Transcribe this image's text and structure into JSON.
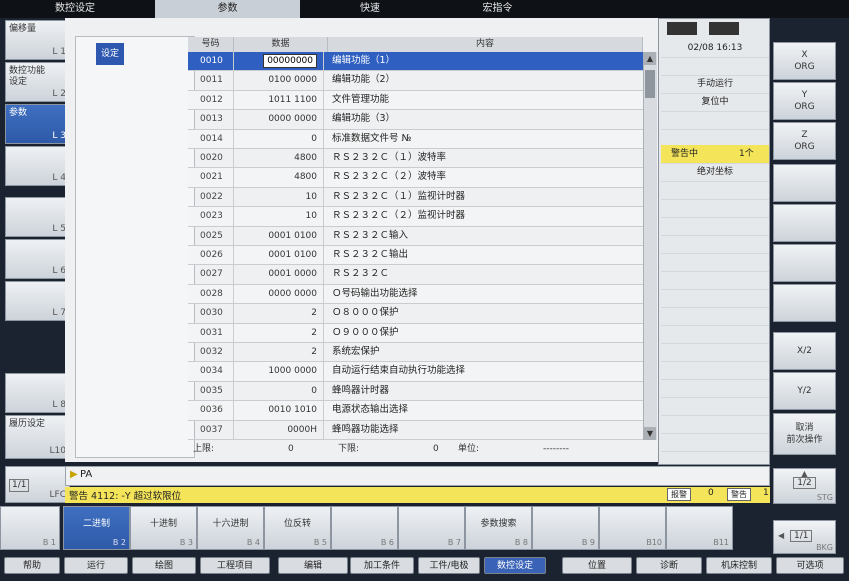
{
  "top_tabs": [
    "数控设定",
    "参数",
    "快速",
    "宏指令"
  ],
  "left_softkeys": [
    {
      "label": "偏移量",
      "key": "L 1"
    },
    {
      "label": "数控功能\n设定",
      "key": "L 2"
    },
    {
      "label": "参数",
      "key": "L 3"
    },
    {
      "label": "",
      "key": "L 4"
    },
    {
      "label": "",
      "key": "L 5"
    },
    {
      "label": "",
      "key": "L 6"
    },
    {
      "label": "",
      "key": "L 7"
    },
    {
      "label": "",
      "key": "L 8"
    },
    {
      "label": "履历设定",
      "key": "L10"
    },
    {
      "label": "1/1",
      "key": "LFC"
    }
  ],
  "nav_button": "设定",
  "table": {
    "headers": [
      "号码",
      "数据",
      "内容"
    ],
    "rows": [
      {
        "no": "0010",
        "data": "00000000",
        "desc": "编辑功能（1）"
      },
      {
        "no": "0011",
        "data": "0100 0000",
        "desc": "编辑功能（2）"
      },
      {
        "no": "0012",
        "data": "1011 1100",
        "desc": "文件管理功能"
      },
      {
        "no": "0013",
        "data": "0000 0000",
        "desc": "编辑功能（3）"
      },
      {
        "no": "0014",
        "data": "0",
        "desc": "标准数据文件号 №"
      },
      {
        "no": "0020",
        "data": "4800",
        "desc": "ＲＳ２３２Ｃ（１）波特率"
      },
      {
        "no": "0021",
        "data": "4800",
        "desc": "ＲＳ２３２Ｃ（２）波特率"
      },
      {
        "no": "0022",
        "data": "10",
        "desc": "ＲＳ２３２Ｃ（１）监视计时器"
      },
      {
        "no": "0023",
        "data": "10",
        "desc": "ＲＳ２３２Ｃ（２）监视计时器"
      },
      {
        "no": "0025",
        "data": "0001 0100",
        "desc": "ＲＳ２３２Ｃ输入"
      },
      {
        "no": "0026",
        "data": "0001 0100",
        "desc": "ＲＳ２３２Ｃ输出"
      },
      {
        "no": "0027",
        "data": "0001 0000",
        "desc": "ＲＳ２３２Ｃ"
      },
      {
        "no": "0028",
        "data": "0000 0000",
        "desc": "Ｏ号码输出功能选择"
      },
      {
        "no": "0030",
        "data": "2",
        "desc": "Ｏ８０００保护"
      },
      {
        "no": "0031",
        "data": "2",
        "desc": "Ｏ９０００保护"
      },
      {
        "no": "0032",
        "data": "2",
        "desc": "系统宏保护"
      },
      {
        "no": "0034",
        "data": "1000 0000",
        "desc": "自动运行结束自动执行功能选择"
      },
      {
        "no": "0035",
        "data": "0",
        "desc": "蜂鸣器计时器"
      },
      {
        "no": "0036",
        "data": "0010 1010",
        "desc": "电源状态输出选择"
      },
      {
        "no": "0037",
        "data": "0000H",
        "desc": "蜂鸣器功能选择"
      }
    ]
  },
  "limits": {
    "upper_label": "上限:",
    "upper_value": "0",
    "lower_label": "下限:",
    "lower_value": "0",
    "unit_label": "单位:",
    "unit_value": "--------"
  },
  "right_panel": {
    "date_time": "02/08  16:13",
    "mode": "手动运行",
    "status": "复位中",
    "warning_label": "警告中",
    "warning_count": "1个",
    "coord": "绝对坐标"
  },
  "right_softkeys": [
    "X\nORG",
    "Y\nORG",
    "Z\nORG",
    "",
    "",
    "",
    "",
    "X/2",
    "Y/2",
    "取消\n前次操作"
  ],
  "cmd_line": "PA",
  "alarm_message": "警告 4112: -Y 超过软限位",
  "alarm_counts": {
    "error_label": "报警",
    "error_count": "0",
    "warn_label": "警告",
    "warn_count": "1"
  },
  "page_right": "1/2",
  "page_right_key": "STG",
  "page_right2": "1/1",
  "page_right2_key": "BKG",
  "bottom_softkeys": [
    {
      "label": "二进制",
      "key": "B 2"
    },
    {
      "label": "十进制",
      "key": "B 3"
    },
    {
      "label": "十六进制",
      "key": "B 4"
    },
    {
      "label": "位反转",
      "key": "B 5"
    },
    {
      "label": "",
      "key": "B 6"
    },
    {
      "label": "",
      "key": "B 7"
    },
    {
      "label": "参数搜索",
      "key": "B 8"
    },
    {
      "label": "",
      "key": "B 9"
    },
    {
      "label": "",
      "key": "B10"
    },
    {
      "label": "",
      "key": "B11"
    }
  ],
  "bottom_left_key": "B 1",
  "hardware_keys": [
    "帮助",
    "运行",
    "绘图",
    "工程项目",
    "编辑",
    "加工条件",
    "工件/电极",
    "数控设定",
    "位置",
    "诊断",
    "机床控制",
    "可选项"
  ]
}
